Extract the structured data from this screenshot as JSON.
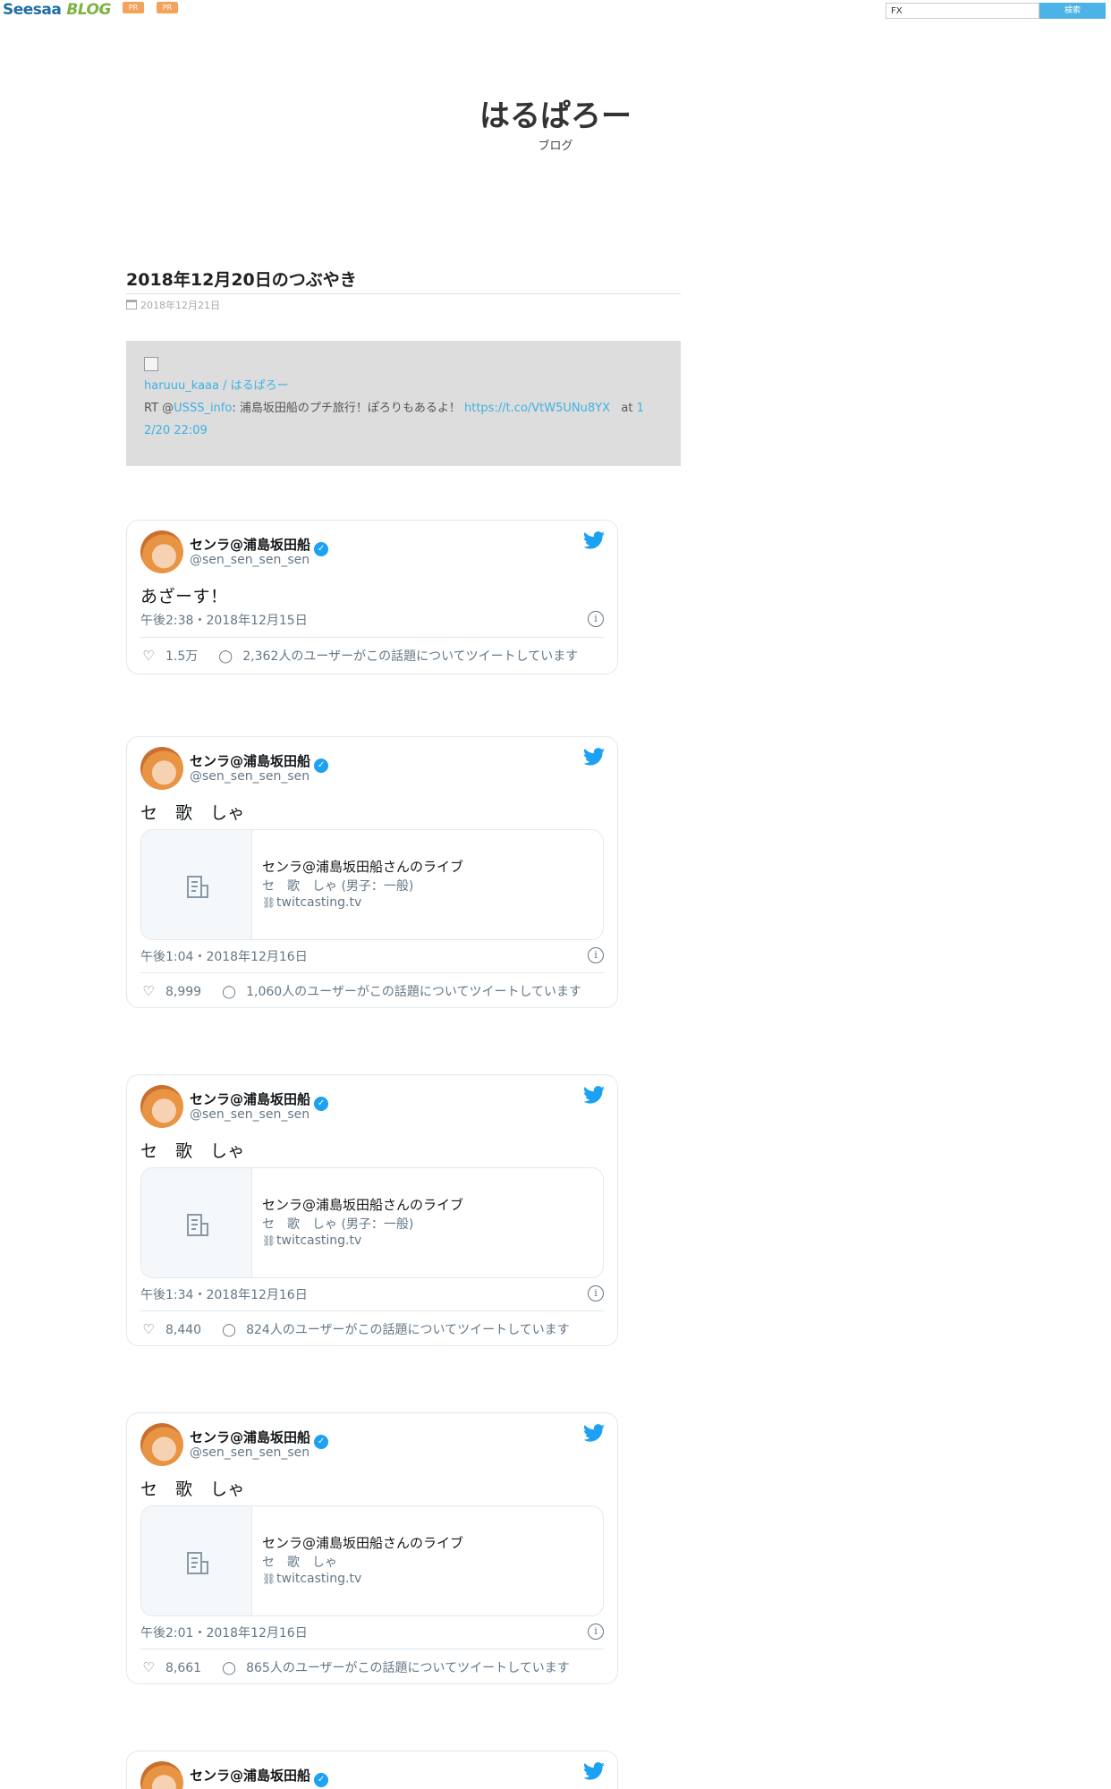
{
  "header": {
    "logo_see": "Seesaa",
    "logo_blog": "BLOG",
    "pr_badges": [
      "PR",
      "PR"
    ],
    "search_value": "FX",
    "search_button": "検索"
  },
  "blog": {
    "title": "はるぱろー",
    "subtitle": "ブログ"
  },
  "article": {
    "title": "2018年12月20日のつぶやき",
    "date": "2018年12月21日",
    "retweet": {
      "user": "haruuu_kaaa / はるぱろー",
      "rt_prefix": "RT @",
      "rt_mention": "USSS_info",
      "rt_text": ": 浦島坂田船のプチ旅行！ぽろりもあるよ！ ",
      "rt_link": "https://t.co/VtW5UNu8YX",
      "at_label": "at",
      "at_time_1": "1",
      "at_time_2": "2/20 22:09"
    }
  },
  "tweets": [
    {
      "name": "センラ@浦島坂田船",
      "handle": "@sen_sen_sen_sen",
      "text": "あざーす！",
      "timestamp": "午後2:38・2018年12月15日",
      "likes": "1.5万",
      "comment_text": "2,362人のユーザーがこの話題についてツイートしています",
      "card": null
    },
    {
      "name": "センラ@浦島坂田船",
      "handle": "@sen_sen_sen_sen",
      "text": "セ　歌　しゃ",
      "timestamp": "午後1:04・2018年12月16日",
      "likes": "8,999",
      "comment_text": "1,060人のユーザーがこの話題についてツイートしています",
      "card": {
        "title": "センラ@浦島坂田船さんのライブ",
        "desc": "セ　歌　しゃ (男子：一般)",
        "url": "twitcasting.tv"
      }
    },
    {
      "name": "センラ@浦島坂田船",
      "handle": "@sen_sen_sen_sen",
      "text": "セ　歌　しゃ",
      "timestamp": "午後1:34・2018年12月16日",
      "likes": "8,440",
      "comment_text": "824人のユーザーがこの話題についてツイートしています",
      "card": {
        "title": "センラ@浦島坂田船さんのライブ",
        "desc": "セ　歌　しゃ (男子：一般)",
        "url": "twitcasting.tv"
      }
    },
    {
      "name": "センラ@浦島坂田船",
      "handle": "@sen_sen_sen_sen",
      "text": "セ　歌　しゃ",
      "timestamp": "午後2:01・2018年12月16日",
      "likes": "8,661",
      "comment_text": "865人のユーザーがこの話題についてツイートしています",
      "card": {
        "title": "センラ@浦島坂田船さんのライブ",
        "desc": "セ　歌　しゃ",
        "url": "twitcasting.tv"
      }
    },
    {
      "name": "センラ@浦島坂田船",
      "handle": null,
      "text": null,
      "timestamp": null,
      "likes": null,
      "comment_text": null,
      "card": null
    }
  ],
  "icons": {
    "verified": "verified-check-icon",
    "twitter": "twitter-bird-icon",
    "info": "info-icon",
    "like": "heart-icon",
    "reply": "speech-bubble-icon",
    "card_placeholder": "document-icon",
    "link": "link-chain-icon"
  },
  "colors": {
    "twitter_blue": "#1da1f2",
    "link_blue": "#3eb1e3",
    "search_button": "#4db3e6",
    "pr_badge": "#f5a35c",
    "rt_box_bg": "#dddddd"
  }
}
